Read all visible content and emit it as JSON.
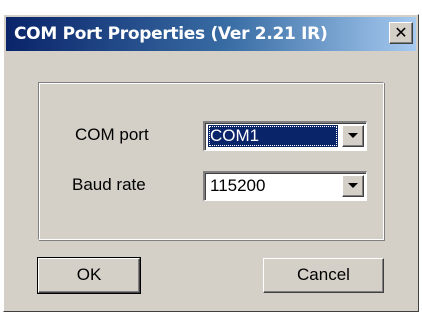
{
  "window": {
    "title": "COM Port Properties (Ver 2.21 IR)",
    "close_glyph": "✕"
  },
  "fields": {
    "com_port": {
      "label": "COM port",
      "value": "COM1"
    },
    "baud_rate": {
      "label": "Baud rate",
      "value": "115200"
    }
  },
  "buttons": {
    "ok_label": "OK",
    "cancel_label": "Cancel"
  },
  "icons": {
    "close": "close-icon",
    "dropdown": "chevron-down-icon"
  },
  "colors": {
    "title_bar_start": "#0a246a",
    "title_bar_end": "#a6caf0",
    "face": "#d4d0c8",
    "selection": "#0a246a"
  }
}
